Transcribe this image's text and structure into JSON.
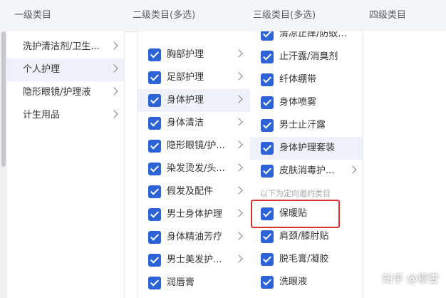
{
  "headers": [
    "一级类目",
    "二级类目(多选)",
    "三级类目(多选)",
    "四级类目"
  ],
  "level1": [
    {
      "label": "洗护清洁剂/卫生..."
    },
    {
      "label": "个人护理"
    },
    {
      "label": "隐形眼镜/护理液"
    },
    {
      "label": "计生用品"
    }
  ],
  "level2": [
    {
      "label": "胸部护理"
    },
    {
      "label": "足部护理"
    },
    {
      "label": "身体护理"
    },
    {
      "label": "身体清洁"
    },
    {
      "label": "隐形眼镜/护..."
    },
    {
      "label": "染发烫发/头..."
    },
    {
      "label": "假发及配件"
    },
    {
      "label": "男士身体护理"
    },
    {
      "label": "身体精油芳疗"
    },
    {
      "label": "男士美发护..."
    },
    {
      "label": "润唇膏"
    }
  ],
  "level3_top": [
    {
      "label": "清凉止痒/防蚊..."
    },
    {
      "label": "止汗露/消臭剂"
    },
    {
      "label": "纤体绷带"
    },
    {
      "label": "身体喷雾"
    },
    {
      "label": "男士止汗露"
    },
    {
      "label": "身体护理套装"
    },
    {
      "label": "皮肤消毒护..."
    }
  ],
  "level3_section_label": "以下为定向邀约类目",
  "level3_bottom": [
    {
      "label": "保暖贴"
    },
    {
      "label": "肩颈/膝肘贴"
    },
    {
      "label": "脱毛膏/凝胶"
    },
    {
      "label": "洗眼液"
    }
  ],
  "watermark": "知乎 @穆雪",
  "colors": {
    "accent": "#2c64d8",
    "highlight": "#d9312b",
    "active_row": "#eef1fb"
  }
}
